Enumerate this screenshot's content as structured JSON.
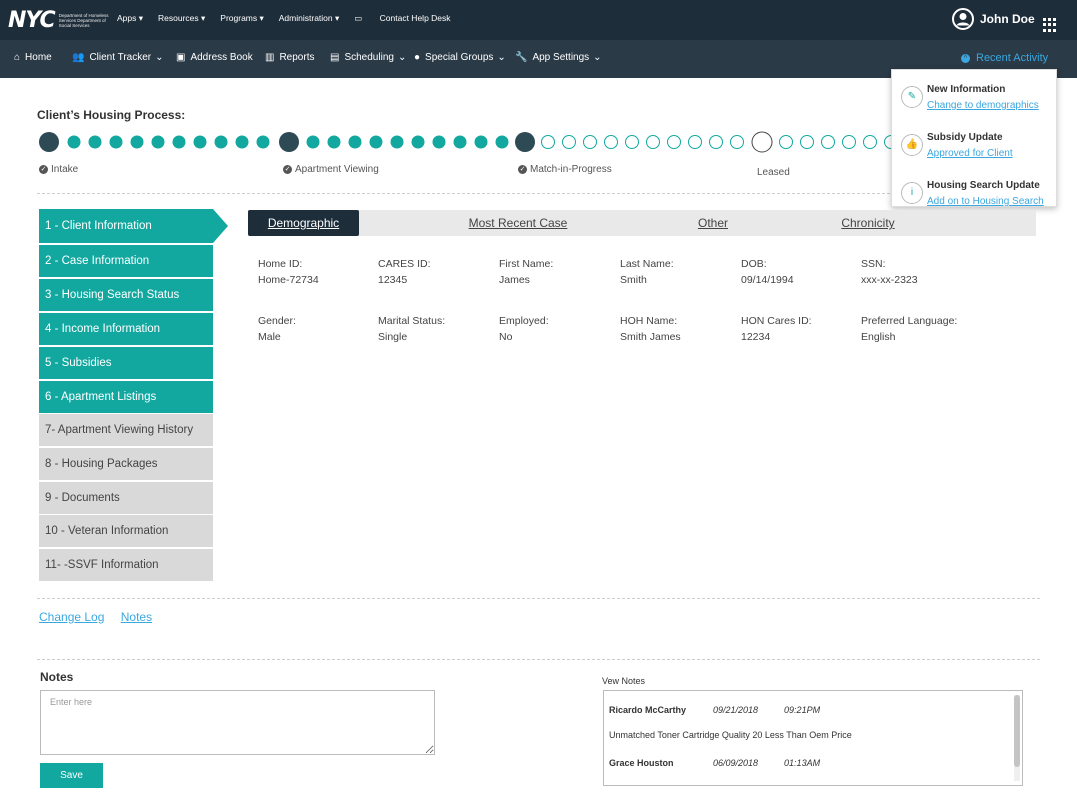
{
  "header": {
    "logo": "NYC",
    "logo_dept": "Department of Homeless Services Department of Social Services",
    "menu": [
      "Apps ▾",
      "Resources ▾",
      "Programs ▾",
      "Administration ▾",
      "Contact Help Desk"
    ],
    "user_name": "John Doe"
  },
  "nav": {
    "items": [
      "Home",
      "Client Tracker",
      "Address Book",
      "Reports",
      "Scheduling",
      "Special Groups",
      "App Settings"
    ],
    "recent_activity": "Recent Activity"
  },
  "process": {
    "title": "Client’s Housing Process:",
    "stages": [
      "Intake",
      "Apartment Viewing",
      "Match-in-Progress",
      "Leased"
    ],
    "colors": {
      "filled": "#12a8a0",
      "milestone": "#2e4a55",
      "empty_border": "#12a8a0"
    }
  },
  "activity": [
    {
      "title": "New Information",
      "link": "Change to demographics",
      "icon": "edit-icon"
    },
    {
      "title": "Subsidy Update",
      "link": "Approved for Client",
      "icon": "thumbs-up-icon"
    },
    {
      "title": "Housing Search Update",
      "link": "Add on to Housing Search",
      "icon": "info-icon"
    }
  ],
  "steps": [
    "1 - Client Information",
    "2 - Case Information",
    "3 - Housing Search Status",
    "4 - Income Information",
    "5 - Subsidies",
    "6 - Apartment Listings",
    "7- Apartment Viewing History",
    "8 - Housing Packages",
    "9 - Documents",
    "10 - Veteran Information",
    "11- -SSVF Information"
  ],
  "tabs": [
    "Demographic",
    "Most Recent Case",
    "Other",
    "Chronicity"
  ],
  "fields": [
    {
      "label": "Home ID:",
      "value": "Home-72734"
    },
    {
      "label": "CARES ID:",
      "value": "12345"
    },
    {
      "label": "First Name:",
      "value": "James"
    },
    {
      "label": "Last Name:",
      "value": "Smith"
    },
    {
      "label": "DOB:",
      "value": "09/14/1994"
    },
    {
      "label": "SSN:",
      "value": "xxx-xx-2323"
    },
    {
      "label": "Gender:",
      "value": "Male"
    },
    {
      "label": "Marital Status:",
      "value": "Single"
    },
    {
      "label": "Employed:",
      "value": "No"
    },
    {
      "label": "HOH Name:",
      "value": "Smith James"
    },
    {
      "label": "HON Cares ID:",
      "value": "12234"
    },
    {
      "label": "Preferred Language:",
      "value": "English"
    }
  ],
  "links": [
    "Change Log",
    "Notes"
  ],
  "notes": {
    "title": "Notes",
    "placeholder": "Enter here",
    "save_label": "Save",
    "view_title": "Vew Notes",
    "entries": [
      {
        "name": "Ricardo McCarthy",
        "date": "09/21/2018",
        "time": "09:21PM",
        "text": "Unmatched Toner Cartridge Quality 20 Less Than Oem Price"
      },
      {
        "name": "Grace Houston",
        "date": "06/09/2018",
        "time": "01:13AM",
        "text": ""
      }
    ]
  }
}
